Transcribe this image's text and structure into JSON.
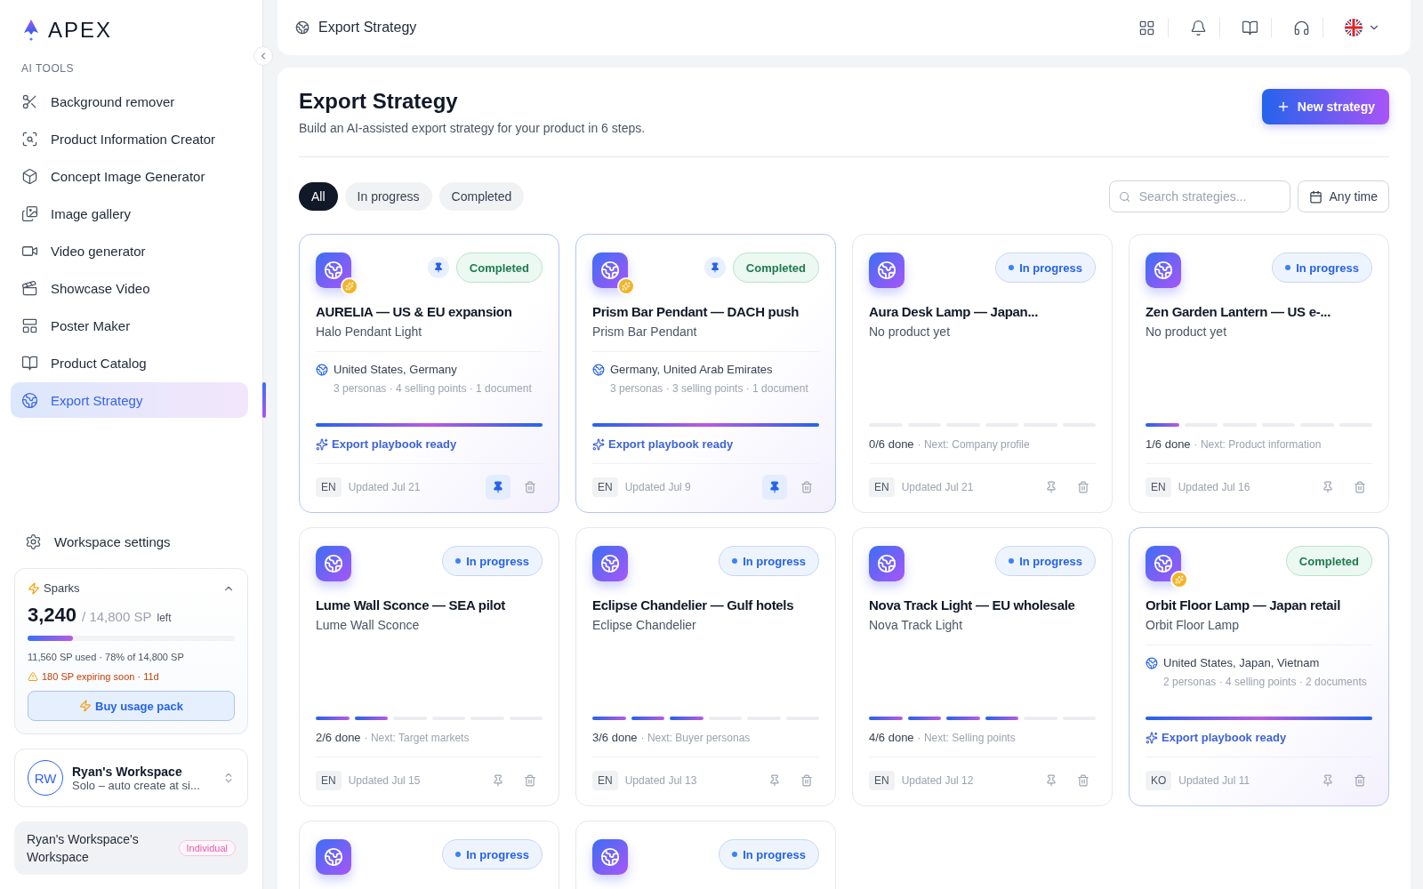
{
  "sidebar": {
    "logo": "APEX",
    "section": "AI TOOLS",
    "items": [
      {
        "label": "Background remover",
        "selected": false
      },
      {
        "label": "Product Information Creator",
        "selected": false
      },
      {
        "label": "Concept Image Generator",
        "selected": false
      },
      {
        "label": "Image gallery",
        "selected": false
      },
      {
        "label": "Video generator",
        "selected": false
      },
      {
        "label": "Showcase Video",
        "selected": false
      },
      {
        "label": "Poster Maker",
        "selected": false
      },
      {
        "label": "Product Catalog",
        "selected": false
      },
      {
        "label": "Export Strategy",
        "selected": true
      }
    ],
    "settings": "Workspace settings",
    "sparks": {
      "title": "Sparks",
      "amount": "3,240",
      "total": "/ 14,800 SP",
      "suffix": "left",
      "level": 0.22,
      "usage": "11,560 SP used · 78% of 14,800 SP",
      "warning": "180 SP expiring soon · 11d",
      "button": "Buy usage pack"
    },
    "workspace": {
      "initials": "RW",
      "name": "Ryan's Workspace",
      "subtitle": "Solo – auto create at si..."
    },
    "account": {
      "name": "Ryan's Workspace's Workspace",
      "badge": "Individual"
    }
  },
  "header": {
    "title": "Export Strategy"
  },
  "page": {
    "title": "Export Strategy",
    "subtitle": "Build an AI-assisted export strategy for your product in 6 steps.",
    "new_button": "New strategy",
    "filters": [
      {
        "label": "All",
        "selected": true
      },
      {
        "label": "In progress",
        "selected": false
      },
      {
        "label": "Completed",
        "selected": false
      }
    ],
    "search": {
      "placeholder": "Search strategies..."
    },
    "date_filter": "Any time"
  },
  "cards": [
    {
      "kind": "completed",
      "title": "AURELIA — US & EU expansion",
      "product": "Halo Pendant Light",
      "status_label": "Completed",
      "pinned": true,
      "markets": "United States, Germany",
      "meta": "3 personas · 4 selling points · 1 document",
      "level": 1,
      "ready": "Export playbook ready",
      "lang": "EN",
      "updated": "Updated Jul 21"
    },
    {
      "kind": "completed",
      "title": "Prism Bar Pendant — DACH push",
      "product": "Prism Bar Pendant",
      "status_label": "Completed",
      "pinned": true,
      "markets": "Germany, United Arab Emirates",
      "meta": "3 personas · 3 selling points · 1 document",
      "level": 1,
      "ready": "Export playbook ready",
      "lang": "EN",
      "updated": "Updated Jul 9"
    },
    {
      "kind": "in_progress",
      "title": "Aura Desk Lamp — Japan...",
      "product": "No product yet",
      "status_label": "In progress",
      "pinned": false,
      "steps": [
        {
          "done": false
        },
        {
          "done": false
        },
        {
          "done": false
        },
        {
          "done": false
        },
        {
          "done": false
        },
        {
          "done": false
        }
      ],
      "done": "0/6 done",
      "next": "· Next: Company profile",
      "lang": "EN",
      "updated": "Updated Jul 21"
    },
    {
      "kind": "in_progress",
      "title": "Zen Garden Lantern — US e-...",
      "product": "No product yet",
      "status_label": "In progress",
      "pinned": false,
      "steps": [
        {
          "done": true
        },
        {
          "done": false
        },
        {
          "done": false
        },
        {
          "done": false
        },
        {
          "done": false
        },
        {
          "done": false
        }
      ],
      "done": "1/6 done",
      "next": "· Next: Product information",
      "lang": "EN",
      "updated": "Updated Jul 16"
    },
    {
      "kind": "in_progress",
      "title": "Lume Wall Sconce — SEA pilot",
      "product": "Lume Wall Sconce",
      "status_label": "In progress",
      "pinned": false,
      "steps": [
        {
          "done": true
        },
        {
          "done": true
        },
        {
          "done": false
        },
        {
          "done": false
        },
        {
          "done": false
        },
        {
          "done": false
        }
      ],
      "done": "2/6 done",
      "next": "· Next: Target markets",
      "lang": "EN",
      "updated": "Updated Jul 15"
    },
    {
      "kind": "in_progress",
      "title": "Eclipse Chandelier — Gulf hotels",
      "product": "Eclipse Chandelier",
      "status_label": "In progress",
      "pinned": false,
      "steps": [
        {
          "done": true
        },
        {
          "done": true
        },
        {
          "done": true
        },
        {
          "done": false
        },
        {
          "done": false
        },
        {
          "done": false
        }
      ],
      "done": "3/6 done",
      "next": "· Next: Buyer personas",
      "lang": "EN",
      "updated": "Updated Jul 13"
    },
    {
      "kind": "in_progress",
      "title": "Nova Track Light — EU wholesale",
      "product": "Nova Track Light",
      "status_label": "In progress",
      "pinned": false,
      "steps": [
        {
          "done": true
        },
        {
          "done": true
        },
        {
          "done": true
        },
        {
          "done": true
        },
        {
          "done": false
        },
        {
          "done": false
        }
      ],
      "done": "4/6 done",
      "next": "· Next: Selling points",
      "lang": "EN",
      "updated": "Updated Jul 12"
    },
    {
      "kind": "completed",
      "title": "Orbit Floor Lamp — Japan retail",
      "product": "Orbit Floor Lamp",
      "status_label": "Completed",
      "pinned": false,
      "markets": "United States, Japan, Vietnam",
      "meta": "2 personas · 4 selling points · 2 documents",
      "level": 1,
      "ready": "Export playbook ready",
      "lang": "KO",
      "updated": "Updated Jul 11"
    },
    {
      "kind": "in_progress",
      "status_label": "In progress",
      "pinned": false
    },
    {
      "kind": "in_progress",
      "status_label": "In progress",
      "pinned": false
    }
  ]
}
